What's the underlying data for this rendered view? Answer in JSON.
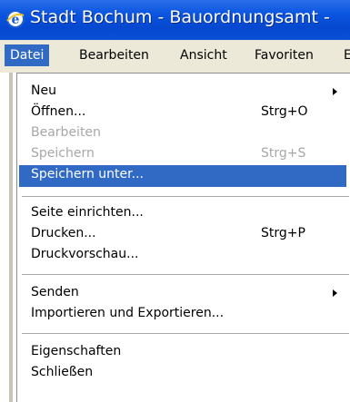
{
  "window": {
    "title": "Stadt Bochum - Bauordnungsamt -"
  },
  "menubar": {
    "items": [
      {
        "label": "Datei"
      },
      {
        "label": "Bearbeiten"
      },
      {
        "label": "Ansicht"
      },
      {
        "label": "Favoriten"
      },
      {
        "label": "E"
      }
    ]
  },
  "dropdown": {
    "items": [
      {
        "label": "Neu",
        "shortcut": "",
        "submenu": true,
        "state": "enabled"
      },
      {
        "label": "Öffnen...",
        "shortcut": "Strg+O",
        "state": "enabled"
      },
      {
        "label": "Bearbeiten",
        "shortcut": "",
        "state": "disabled"
      },
      {
        "label": "Speichern",
        "shortcut": "Strg+S",
        "state": "disabled"
      },
      {
        "label": "Speichern unter...",
        "shortcut": "",
        "state": "highlighted"
      },
      {
        "label": "Seite einrichten...",
        "shortcut": "",
        "state": "enabled"
      },
      {
        "label": "Drucken...",
        "shortcut": "Strg+P",
        "state": "enabled"
      },
      {
        "label": "Druckvorschau...",
        "shortcut": "",
        "state": "enabled"
      },
      {
        "label": "Senden",
        "shortcut": "",
        "submenu": true,
        "state": "enabled"
      },
      {
        "label": "Importieren und Exportieren...",
        "shortcut": "",
        "state": "enabled"
      },
      {
        "label": "Eigenschaften",
        "shortcut": "",
        "state": "enabled"
      },
      {
        "label": "Schließen",
        "shortcut": "",
        "state": "enabled"
      }
    ]
  },
  "colors": {
    "titlebar": "#0a55e0",
    "menubar": "#ece9d8",
    "highlight": "#316ac5",
    "disabled_text": "#a7a7a7"
  },
  "icons": {
    "app": "internet-explorer-icon",
    "submenu": "submenu-arrow-icon"
  }
}
